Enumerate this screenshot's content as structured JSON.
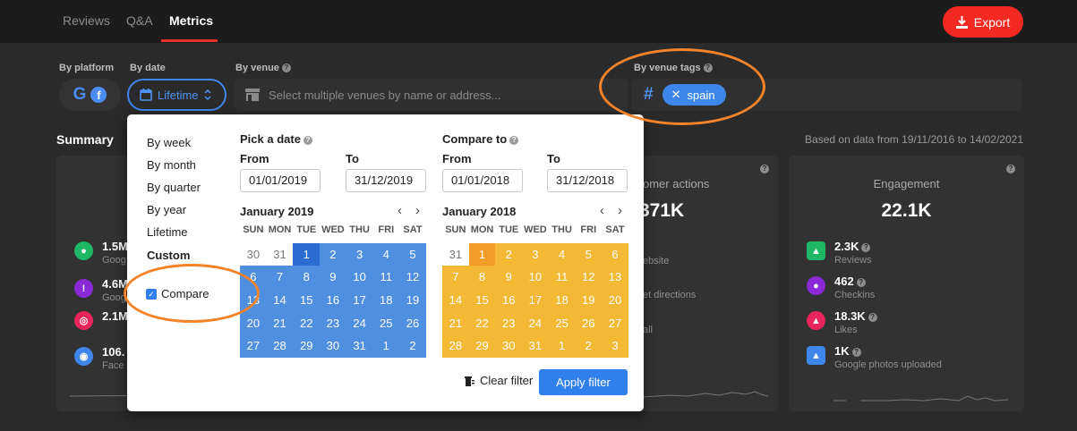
{
  "tabs": [
    {
      "label": "Reviews"
    },
    {
      "label": "Q&A"
    },
    {
      "label": "Metrics"
    }
  ],
  "export_label": "Export",
  "filters": {
    "platform_label": "By platform",
    "date_label": "By date",
    "venue_label": "By venue",
    "tags_label": "By venue tags",
    "date_value": "Lifetime",
    "venue_placeholder": "Select multiple venues by name or address...",
    "tag_chip": "spain"
  },
  "summary": {
    "title": "Summary",
    "data_range": "Based on data from 19/11/2016 to 14/02/2021",
    "card1_rows": [
      {
        "value": "1.5M",
        "label": "Goog",
        "icon": "location-pin-icon",
        "color": "#1eb765"
      },
      {
        "value": "4.6M",
        "label": "Goog",
        "icon": "alert-badge-icon",
        "color": "#8a2ad6"
      },
      {
        "value": "2.1M",
        "label": "",
        "icon": "target-icon",
        "color": "#e8255a"
      },
      {
        "value": "106.",
        "label": "Face",
        "icon": "eye-icon",
        "color": "#3f86ea"
      }
    ],
    "card2": {
      "title": "omer actions",
      "value": "371K",
      "lines": [
        "ebsite",
        "et directions",
        "all"
      ]
    },
    "card3": {
      "title": "Engagement",
      "value": "22.1K",
      "rows": [
        {
          "value": "2.3K",
          "label": "Reviews",
          "icon": "image-icon",
          "color": "#1eb765"
        },
        {
          "value": "462",
          "label": "Checkins",
          "icon": "location-pin-icon",
          "color": "#8a2ad6"
        },
        {
          "value": "18.3K",
          "label": "Likes",
          "icon": "thumbs-up-icon",
          "color": "#e8255a"
        },
        {
          "value": "1K",
          "label": "Google photos uploaded",
          "icon": "photo-icon",
          "color": "#3f86ea"
        }
      ]
    }
  },
  "popup": {
    "ranges": [
      "By week",
      "By month",
      "By quarter",
      "By year",
      "Lifetime",
      "Custom"
    ],
    "compare_label": "Compare",
    "pick_title": "Pick a date",
    "compare_title": "Compare to",
    "from_label": "From",
    "to_label": "To",
    "pick_from": "01/01/2019",
    "pick_to": "31/12/2019",
    "compare_from": "01/01/2018",
    "compare_to": "31/12/2018",
    "weekdays": [
      "SUN",
      "MON",
      "TUE",
      "WED",
      "THU",
      "FRI",
      "SAT"
    ],
    "cal1": {
      "title": "January 2019",
      "color": "#4e8fe0",
      "days": [
        [
          "30",
          "31",
          "1",
          "2",
          "3",
          "4",
          "5"
        ],
        [
          "6",
          "7",
          "8",
          "9",
          "10",
          "11",
          "12"
        ],
        [
          "13",
          "14",
          "15",
          "16",
          "17",
          "18",
          "19"
        ],
        [
          "20",
          "21",
          "22",
          "23",
          "24",
          "25",
          "26"
        ],
        [
          "27",
          "28",
          "29",
          "30",
          "31",
          "1",
          "2"
        ]
      ],
      "outside_leading": 2
    },
    "cal2": {
      "title": "January 2018",
      "color": "#f4b934",
      "days": [
        [
          "31",
          "1",
          "2",
          "3",
          "4",
          "5",
          "6"
        ],
        [
          "7",
          "8",
          "9",
          "10",
          "11",
          "12",
          "13"
        ],
        [
          "14",
          "15",
          "16",
          "17",
          "18",
          "19",
          "20"
        ],
        [
          "21",
          "22",
          "23",
          "24",
          "25",
          "26",
          "27"
        ],
        [
          "28",
          "29",
          "30",
          "31",
          "1",
          "2",
          "3"
        ]
      ],
      "outside_leading": 1
    },
    "clear_label": "Clear filter",
    "apply_label": "Apply filter"
  }
}
